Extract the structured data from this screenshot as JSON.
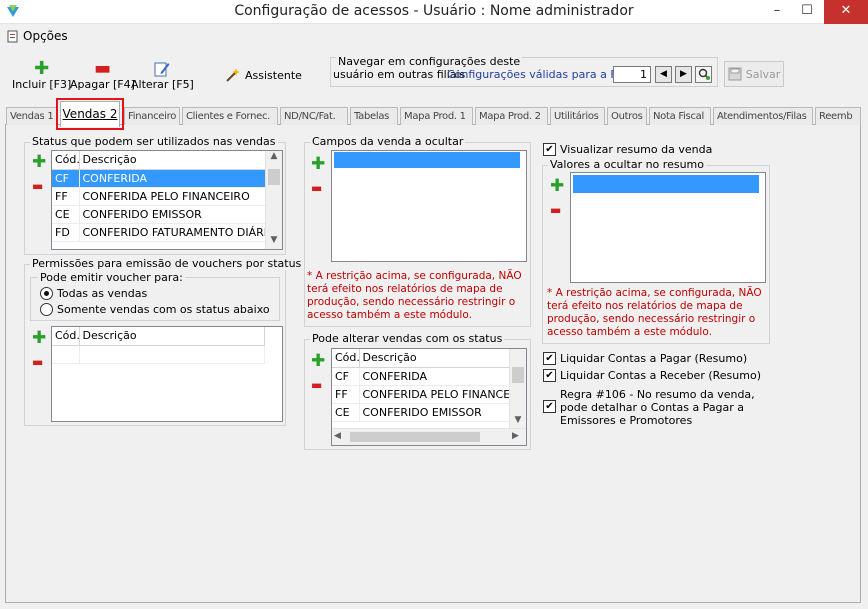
{
  "window": {
    "title": "Configuração de acessos - Usuário : Nome administrador",
    "minimize": "–",
    "maximize": "☐",
    "close": "✕"
  },
  "menu": {
    "options_label": "Opções"
  },
  "toolbar": {
    "incluir": "Incluir [F3]",
    "apagar": "Apagar [F4]",
    "alterar": "Alterar [F5]",
    "assistente": "Assistente",
    "nav_legend_line1": "Navegar em configurações deste",
    "nav_legend_line2": "usuário em outras filiais",
    "nav_link": "Configurações válidas para a Filial",
    "filial_value": "1",
    "salvar": "Salvar"
  },
  "tabs": [
    {
      "label": "Vendas 1"
    },
    {
      "label": "Vendas 2",
      "active": true
    },
    {
      "label": "Financeiro"
    },
    {
      "label": "Clientes e Fornec."
    },
    {
      "label": "ND/NC/Fat."
    },
    {
      "label": "Tabelas"
    },
    {
      "label": "Mapa Prod. 1"
    },
    {
      "label": "Mapa Prod. 2"
    },
    {
      "label": "Utilitários"
    },
    {
      "label": "Outros"
    },
    {
      "label": "Nota Fiscal"
    },
    {
      "label": "Atendimentos/Filas"
    },
    {
      "label": "Reemb"
    }
  ],
  "status_group": {
    "title": "Status que podem ser utilizados nas vendas",
    "col_cod": "Cód.",
    "col_desc": "Descrição",
    "rows": [
      {
        "cod": "CF",
        "desc": "CONFERIDA",
        "selected": true
      },
      {
        "cod": "FF",
        "desc": "CONFERIDA PELO FINANCEIRO"
      },
      {
        "cod": "CE",
        "desc": "CONFERIDO EMISSOR"
      },
      {
        "cod": "FD",
        "desc": "CONFERIDO FATURAMENTO DIÁRIO"
      }
    ]
  },
  "voucher_group": {
    "title": "Permissões para emissão de vouchers por status",
    "sub_title": "Pode emitir voucher para:",
    "radio_all": "Todas as vendas",
    "radio_some": "Somente vendas com os status abaixo",
    "col_cod": "Cód.",
    "col_desc": "Descrição"
  },
  "campos_group": {
    "title": "Campos da venda a ocultar",
    "warning": "* A restrição acima, se configurada, NÃO terá efeito nos relatórios de mapa de produção, sendo necessário restringir o acesso também a este módulo."
  },
  "alterar_group": {
    "title": "Pode alterar vendas com os status",
    "col_cod": "Cód.",
    "col_desc": "Descrição",
    "rows": [
      {
        "cod": "CF",
        "desc": "CONFERIDA"
      },
      {
        "cod": "FF",
        "desc": "CONFERIDA PELO FINANCEIRO"
      },
      {
        "cod": "CE",
        "desc": "CONFERIDO EMISSOR"
      }
    ]
  },
  "resumo": {
    "visualizar_label": "Visualizar resumo da venda",
    "valores_title": "Valores a ocultar no resumo",
    "warning": "* A restrição acima, se configurada, NÃO terá efeito nos relatórios de mapa de produção, sendo necessário restringir o acesso também a este módulo.",
    "liquidar_pagar": "Liquidar Contas a Pagar (Resumo)",
    "liquidar_receber": "Liquidar Contas a Receber (Resumo)",
    "regra_106": "Regra #106 - No resumo da venda, pode detalhar o Contas a Pagar a Emissores e Promotores"
  },
  "colors": {
    "selection": "#3399ff",
    "plus": "#2aa02a",
    "minus": "#d21f1f",
    "warning": "#c00000",
    "highlight": "#e0141a"
  }
}
